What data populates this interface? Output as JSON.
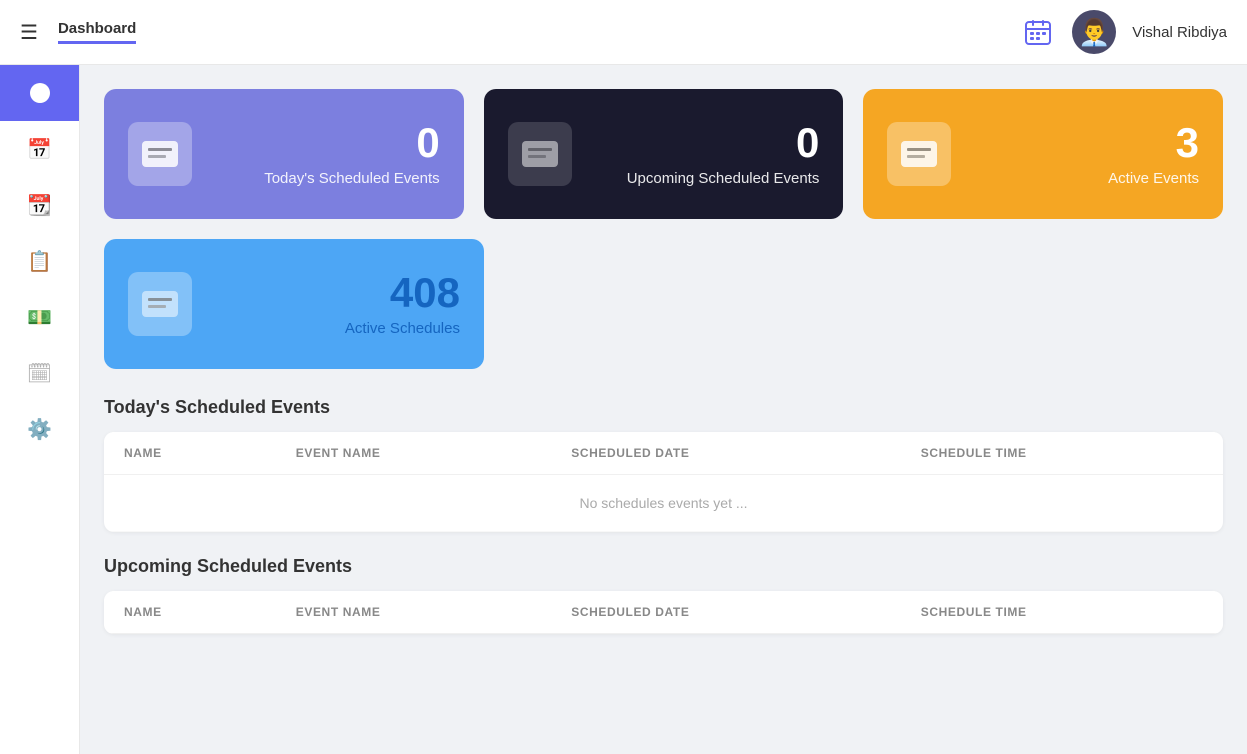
{
  "topnav": {
    "menu_icon": "≡",
    "title": "Dashboard",
    "username": "Vishal Ribdiya"
  },
  "sidebar": {
    "items": [
      {
        "id": "home",
        "icon": "⬤",
        "active": true
      },
      {
        "id": "calendar1",
        "icon": "📅",
        "active": false
      },
      {
        "id": "calendar2",
        "icon": "📆",
        "active": false
      },
      {
        "id": "event",
        "icon": "📋",
        "active": false
      },
      {
        "id": "money",
        "icon": "💰",
        "active": false
      },
      {
        "id": "schedule",
        "icon": "📅",
        "active": false
      },
      {
        "id": "settings",
        "icon": "⚙",
        "active": false
      }
    ]
  },
  "cards": [
    {
      "id": "today-events",
      "theme": "purple",
      "number": "0",
      "label": "Today's Scheduled Events"
    },
    {
      "id": "upcoming-events",
      "theme": "dark",
      "number": "0",
      "label": "Upcoming Scheduled Events"
    },
    {
      "id": "active-events",
      "theme": "orange",
      "number": "3",
      "label": "Active Events"
    }
  ],
  "cards_row2": [
    {
      "id": "active-schedules",
      "theme": "blue",
      "number": "408",
      "label": "Active Schedules"
    }
  ],
  "todays_table": {
    "title": "Today's Scheduled Events",
    "columns": [
      "NAME",
      "EVENT NAME",
      "SCHEDULED DATE",
      "SCHEDULE TIME"
    ],
    "empty_message": "No schedules events yet ...",
    "rows": []
  },
  "upcoming_table": {
    "title": "Upcoming Scheduled Events",
    "columns": [
      "NAME",
      "EVENT NAME",
      "SCHEDULED DATE",
      "SCHEDULE TIME"
    ],
    "rows": []
  }
}
